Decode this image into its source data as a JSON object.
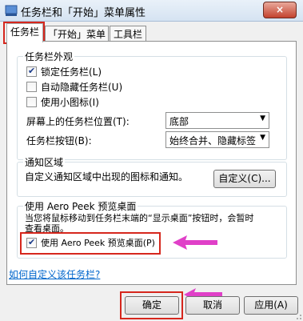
{
  "window": {
    "title": "任务栏和「开始」菜单属性",
    "close_label": "×"
  },
  "tabs": [
    {
      "label": "任务栏",
      "active": true
    },
    {
      "label": "「开始」菜单",
      "active": false
    },
    {
      "label": "工具栏",
      "active": false
    }
  ],
  "appearance": {
    "title": "任务栏外观",
    "lock": {
      "label": "锁定任务栏(L)",
      "checked": true
    },
    "autohide": {
      "label": "自动隐藏任务栏(U)",
      "checked": false
    },
    "small_icons": {
      "label": "使用小图标(I)",
      "checked": false
    },
    "position": {
      "label": "屏幕上的任务栏位置(T):",
      "value": "底部"
    },
    "buttons": {
      "label": "任务栏按钮(B):",
      "value": "始终合并、隐藏标签"
    }
  },
  "notify": {
    "title": "通知区域",
    "description": "自定义通知区域中出现的图标和通知。",
    "customize_button": "自定义(C)..."
  },
  "peek": {
    "title": "使用 Aero Peek 预览桌面",
    "description_line1": "当您将鼠标移动到任务栏末端的“显示桌面”按钮时，会暂时",
    "description_line2": "查看桌面。",
    "checkbox": {
      "label": "使用 Aero Peek 预览桌面(P)",
      "checked": true
    }
  },
  "help_link": "如何自定义该任务栏?",
  "footer": {
    "ok": "确定",
    "cancel": "取消",
    "apply": "应用(A)"
  },
  "colors": {
    "highlight": "#d6271d",
    "arrow": "#e040c8",
    "link": "#0066cc"
  }
}
